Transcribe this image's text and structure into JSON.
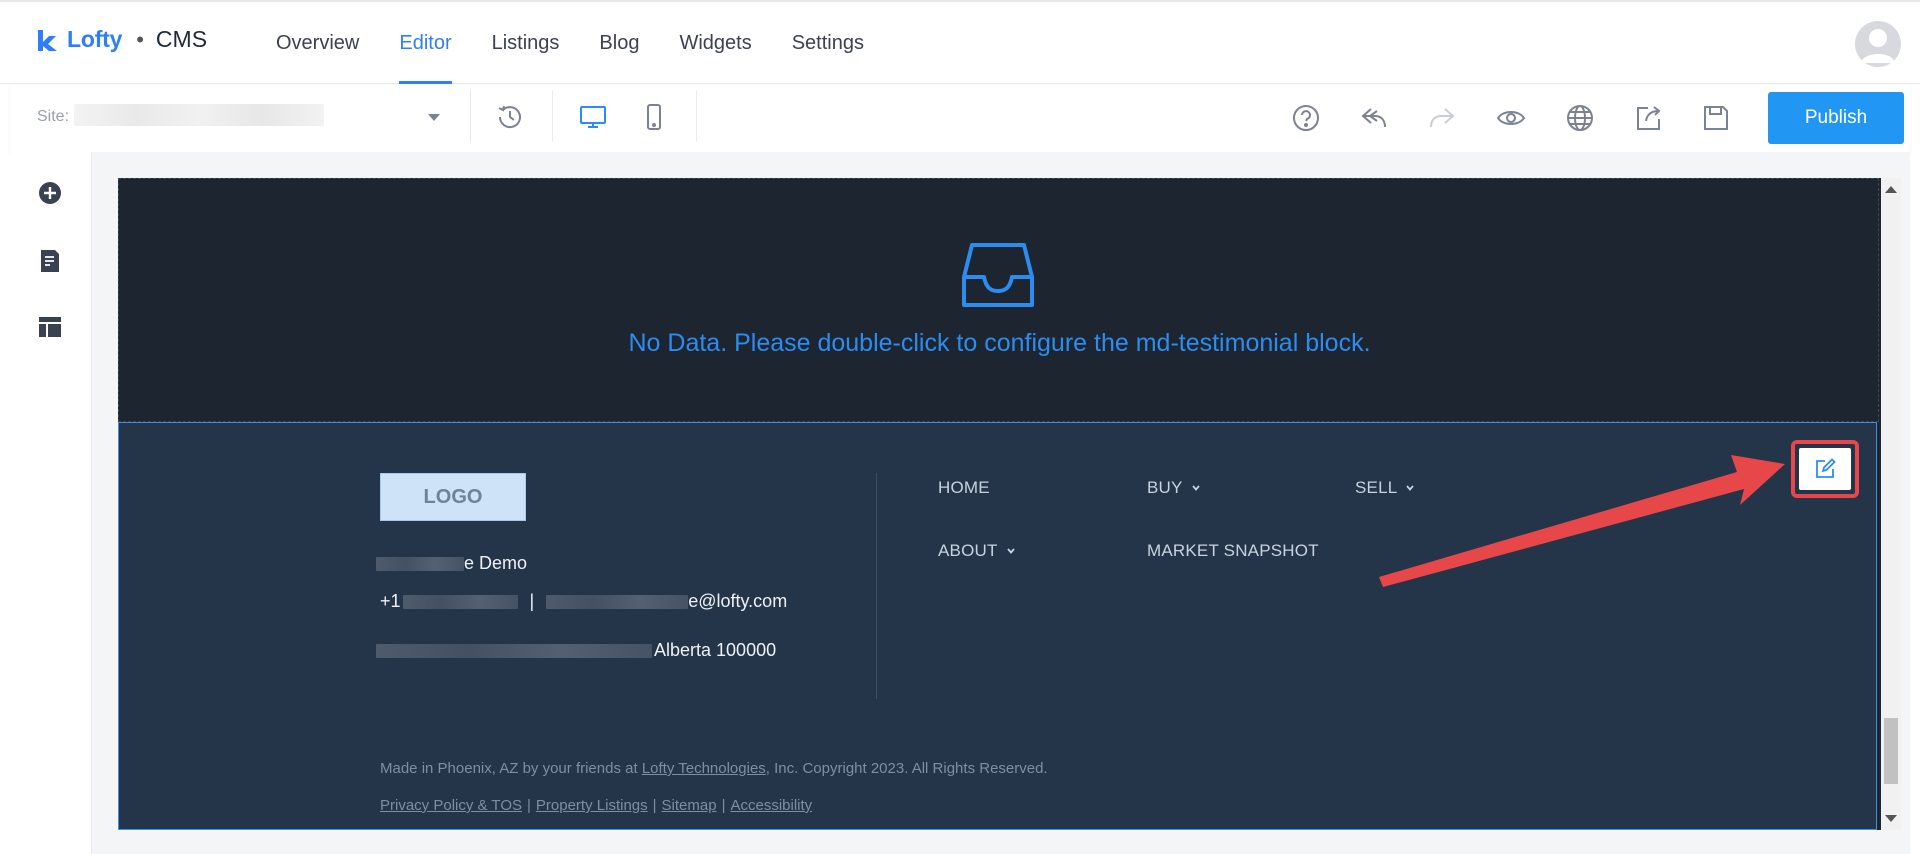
{
  "brand": {
    "name": "Lofty",
    "separator": "•",
    "product": "CMS",
    "accent": "#2d7ff9"
  },
  "nav": {
    "items": [
      {
        "label": "Overview",
        "active": false
      },
      {
        "label": "Editor",
        "active": true
      },
      {
        "label": "Listings",
        "active": false
      },
      {
        "label": "Blog",
        "active": false
      },
      {
        "label": "Widgets",
        "active": false
      },
      {
        "label": "Settings",
        "active": false
      }
    ]
  },
  "toolbar": {
    "site_label": "Site:",
    "icons": [
      "history-icon",
      "desktop-icon",
      "mobile-icon",
      "help-icon",
      "undo-icon",
      "redo-icon",
      "preview-icon",
      "globe-icon",
      "export-icon",
      "save-icon"
    ],
    "publish_label": "Publish",
    "publish_color": "#2196f3"
  },
  "rail": {
    "icons": [
      "add-circle-icon",
      "page-icon",
      "layout-icon"
    ]
  },
  "canvas": {
    "testimonial": {
      "message": "No Data. Please double-click to configure the md-testimonial block.",
      "message_color": "#2d8cf0"
    },
    "footer": {
      "logo_text": "LOGO",
      "contact_name_suffix": "e Demo",
      "phone_prefix": "+1",
      "phone_sep": "|",
      "email_suffix": "e@lofty.com",
      "address_suffix": "Alberta 100000",
      "menu": [
        {
          "label": "HOME",
          "has_dropdown": false
        },
        {
          "label": "BUY",
          "has_dropdown": true
        },
        {
          "label": "SELL",
          "has_dropdown": true
        },
        {
          "label": "ABOUT",
          "has_dropdown": true
        },
        {
          "label": "MARKET SNAPSHOT",
          "has_dropdown": false
        }
      ],
      "copyright_prefix": "Made in Phoenix, AZ by your friends at ",
      "copyright_link": "Lofty Technologies",
      "copyright_suffix": ", Inc. Copyright 2023. All Rights Reserved.",
      "links": [
        "Privacy Policy & TOS",
        "Property Listings",
        "Sitemap",
        "Accessibility"
      ],
      "link_separator": "|",
      "edit_icon": "edit-icon",
      "highlight_color": "#e8474a"
    }
  }
}
